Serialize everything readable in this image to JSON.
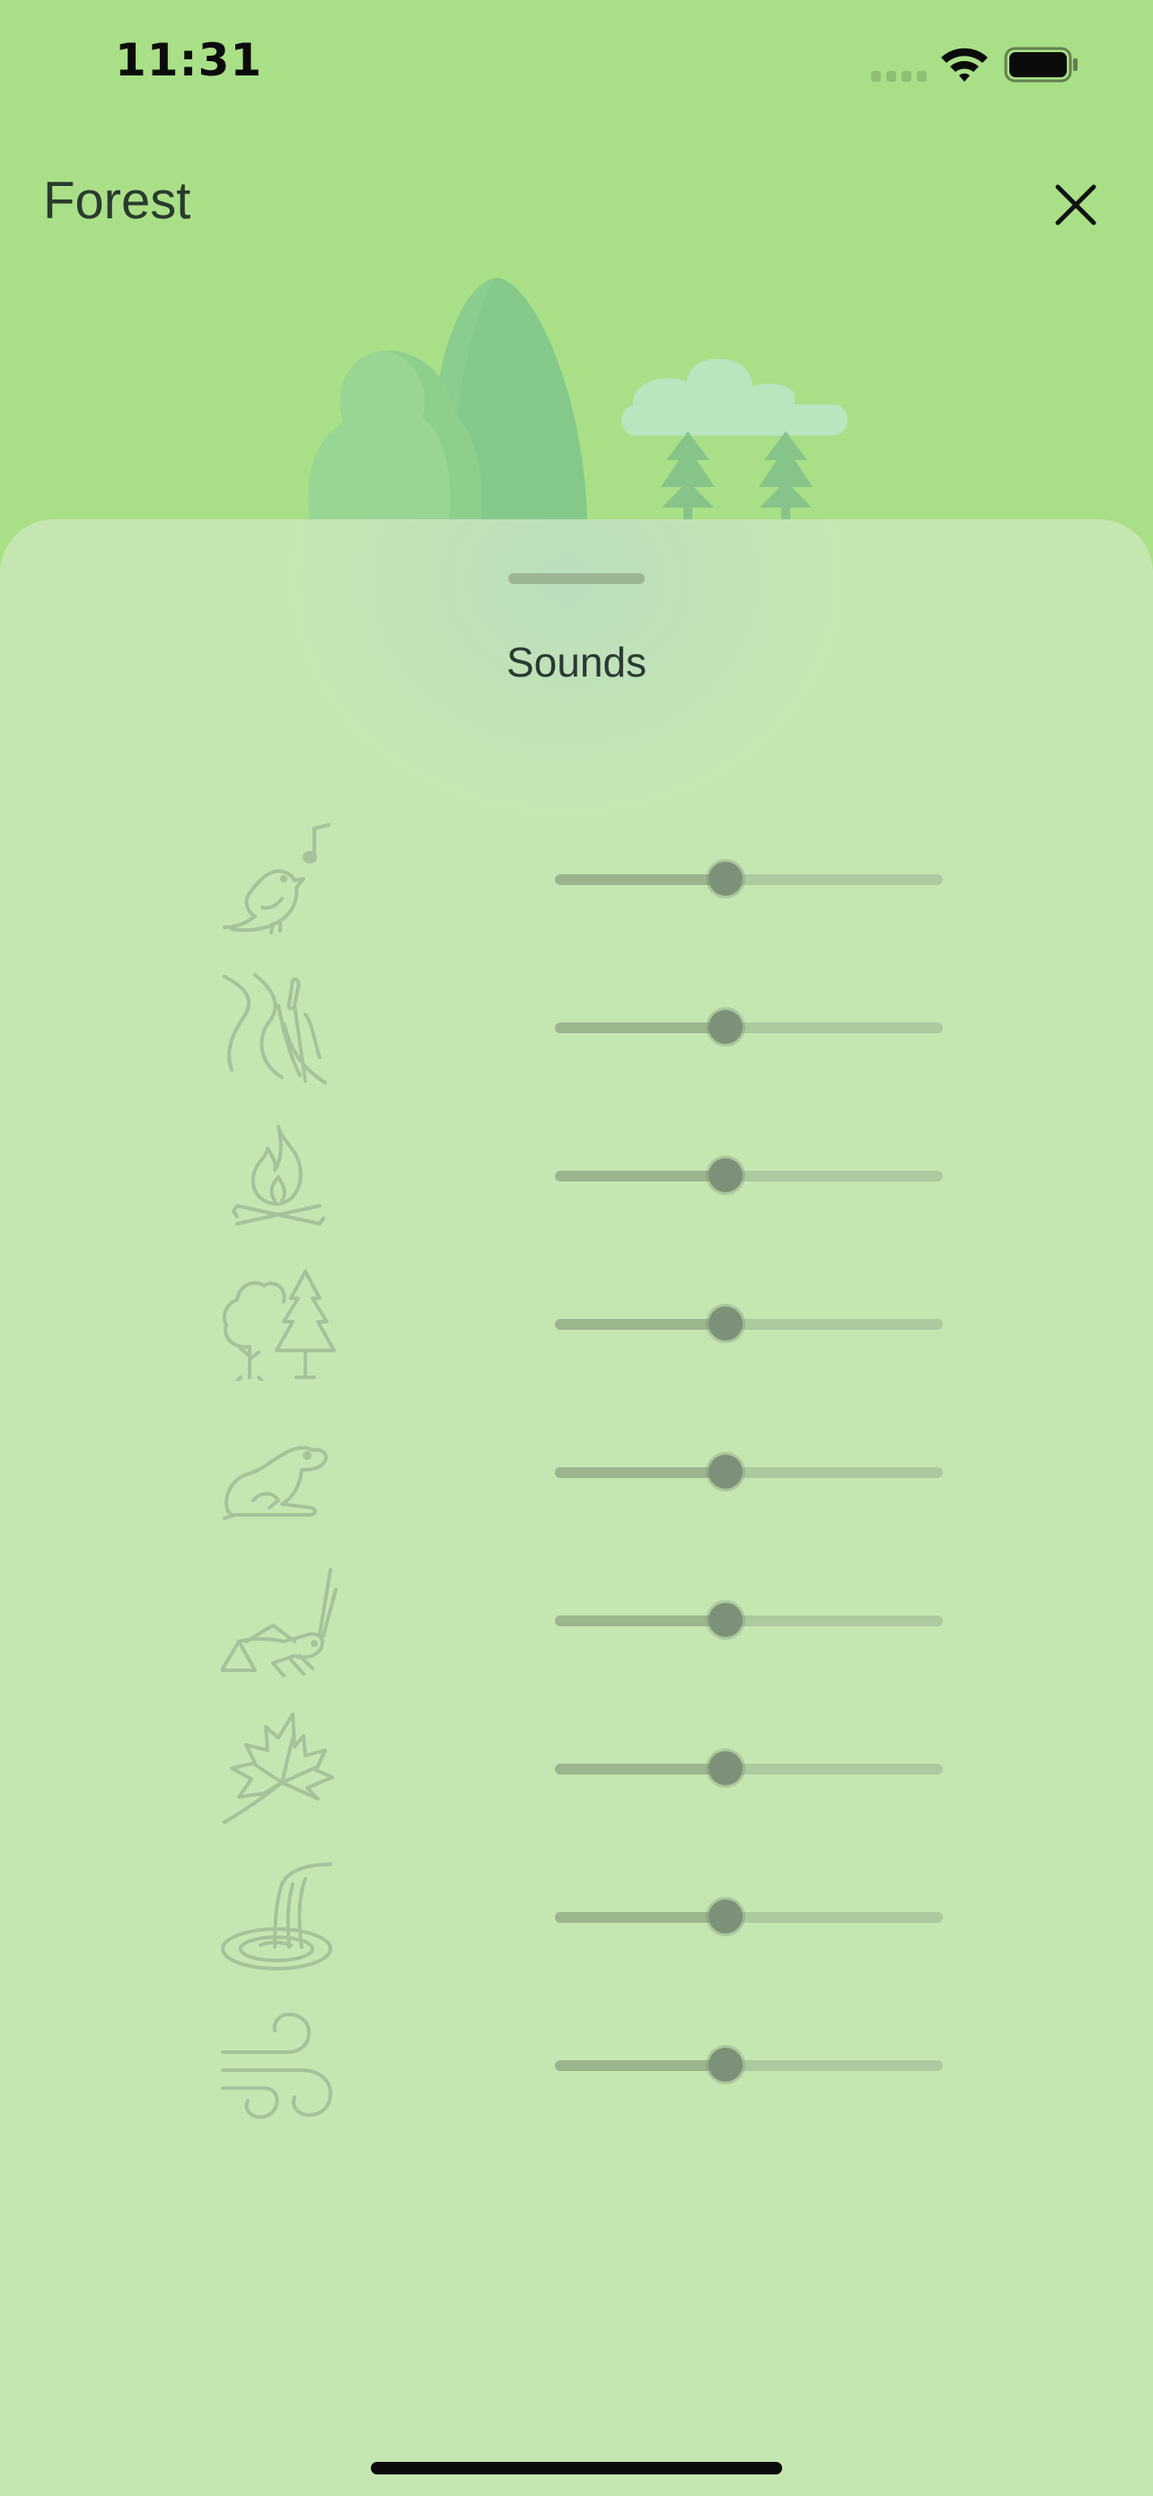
{
  "status_bar": {
    "time": "11:31"
  },
  "header": {
    "title": "Forest"
  },
  "sheet": {
    "title": "Sounds",
    "sounds": [
      {
        "icon": "bird-icon",
        "level": 0.44
      },
      {
        "icon": "stream-reeds-icon",
        "level": 0.44
      },
      {
        "icon": "campfire-icon",
        "level": 0.44
      },
      {
        "icon": "trees-icon",
        "level": 0.44
      },
      {
        "icon": "frog-icon",
        "level": 0.44
      },
      {
        "icon": "cricket-icon",
        "level": 0.44
      },
      {
        "icon": "leaf-icon",
        "level": 0.44
      },
      {
        "icon": "waterfall-icon",
        "level": 0.44
      },
      {
        "icon": "wind-icon",
        "level": 0.44
      }
    ]
  },
  "colors": {
    "background": "#a9e087",
    "sheet": "#c6e6b1",
    "icon_stroke": "#a6c29a",
    "slider_thumb": "#7c9278"
  }
}
